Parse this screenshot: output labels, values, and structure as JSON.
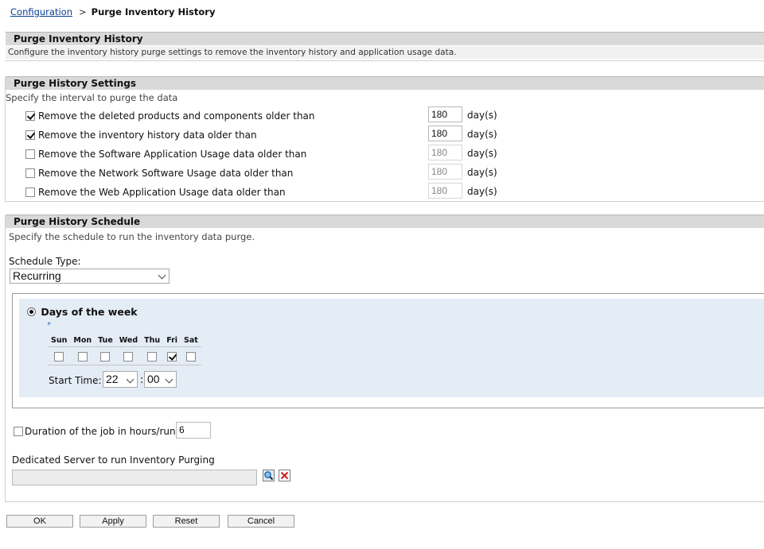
{
  "breadcrumb": {
    "parent": "Configuration",
    "separator": ">",
    "current": "Purge Inventory History"
  },
  "intro": {
    "title": "Purge Inventory History",
    "description": "Configure the inventory history purge settings to remove the inventory history and application usage data."
  },
  "settings": {
    "title": "Purge History Settings",
    "description": "Specify the interval to purge the data",
    "unit": "day(s)",
    "rows": [
      {
        "label": "Remove the deleted products and components older than",
        "checked": true,
        "value": "180"
      },
      {
        "label": "Remove the inventory history data older than",
        "checked": true,
        "value": "180"
      },
      {
        "label": "Remove the Software Application Usage data older than",
        "checked": false,
        "value": "180"
      },
      {
        "label": "Remove the Network Software Usage data older than",
        "checked": false,
        "value": "180"
      },
      {
        "label": "Remove the Web Application Usage data older than",
        "checked": false,
        "value": "180"
      }
    ]
  },
  "schedule": {
    "title": "Purge History Schedule",
    "description": "Specify the schedule to run the inventory data purge.",
    "type_label": "Schedule Type:",
    "type_value": "Recurring",
    "days_of_week_label": "Days of the week",
    "required_marker": "*",
    "days": [
      {
        "label": "Sun",
        "checked": false
      },
      {
        "label": "Mon",
        "checked": false
      },
      {
        "label": "Tue",
        "checked": false
      },
      {
        "label": "Wed",
        "checked": false
      },
      {
        "label": "Thu",
        "checked": false
      },
      {
        "label": "Fri",
        "checked": true
      },
      {
        "label": "Sat",
        "checked": false
      }
    ],
    "start_time_label": "Start Time:",
    "hour": "22",
    "time_separator": ":",
    "minute": "00",
    "duration_label": "Duration of the job in hours/run",
    "duration_value": "6",
    "duration_checked": false,
    "server_label": "Dedicated Server to run Inventory Purging",
    "server_value": ""
  },
  "buttons": {
    "ok": "OK",
    "apply": "Apply",
    "reset": "Reset",
    "cancel": "Cancel"
  },
  "colors": {
    "link": "#0b3d91",
    "header_bg": "#d9d9d9",
    "panel_bg": "#e4ecf6",
    "clear_icon": "#d42020",
    "search_icon": "#2a6db0"
  }
}
